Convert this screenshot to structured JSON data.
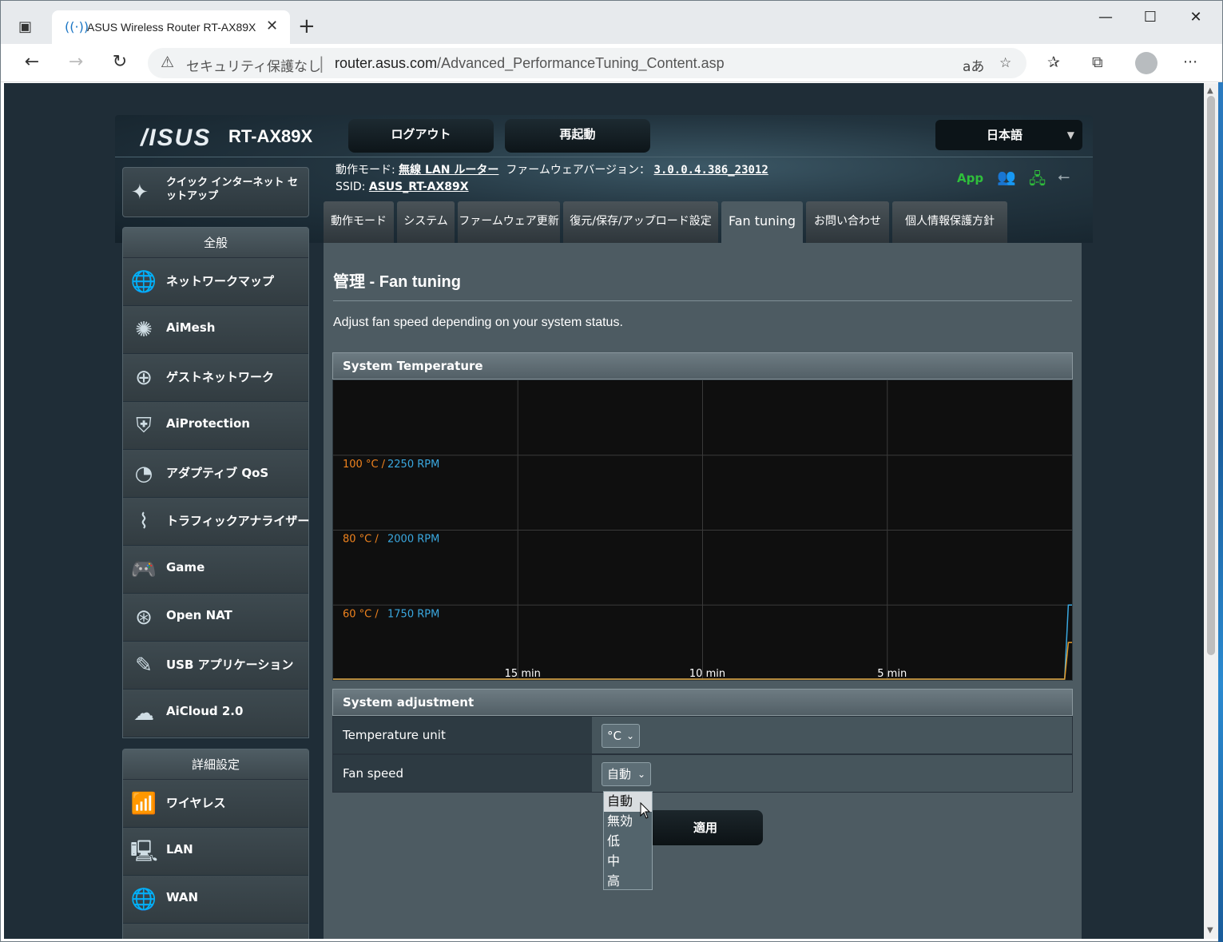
{
  "browser": {
    "tab_title": "ASUS Wireless Router RT-AX89X",
    "security_label": "セキュリティ保護なし",
    "url_host": "router.asus.com",
    "url_path": "/Advanced_PerformanceTuning_Content.asp"
  },
  "header": {
    "brand": "/ISUS",
    "model": "RT-AX89X",
    "logout_label": "ログアウト",
    "reboot_label": "再起動",
    "language": "日本語",
    "op_mode_label": "動作モード:",
    "op_mode_value": "無線 LAN ルーター",
    "fw_label": "ファームウェアバージョン：",
    "fw_value": "3.0.0.4.386_23012",
    "ssid_label": "SSID:",
    "ssid_value": "ASUS_RT-AX89X",
    "app_label": "App"
  },
  "sidebar": {
    "qis_label": "クイック インターネット セットアップ",
    "general_header": "全般",
    "general_items": [
      {
        "label": "ネットワークマップ",
        "icon": "globe-network-icon"
      },
      {
        "label": "AiMesh",
        "icon": "aimesh-icon"
      },
      {
        "label": "ゲストネットワーク",
        "icon": "guest-network-icon"
      },
      {
        "label": "AiProtection",
        "icon": "shield-lock-icon"
      },
      {
        "label": "アダプティブ QoS",
        "icon": "gauge-icon"
      },
      {
        "label": "トラフィックアナライザー",
        "icon": "traffic-pulse-icon"
      },
      {
        "label": "Game",
        "icon": "gamepad-icon"
      },
      {
        "label": "Open NAT",
        "icon": "open-nat-icon"
      },
      {
        "label": "USB アプリケーション",
        "icon": "usb-icon"
      },
      {
        "label": "AiCloud 2.0",
        "icon": "cloud-icon"
      }
    ],
    "advanced_header": "詳細設定",
    "advanced_items": [
      {
        "label": "ワイヤレス",
        "icon": "wireless-icon"
      },
      {
        "label": "LAN",
        "icon": "lan-icon"
      },
      {
        "label": "WAN",
        "icon": "wan-globe-icon"
      }
    ]
  },
  "tabs": [
    "動作モード",
    "システム",
    "ファームウェア更新",
    "復元/保存/アップロード設定",
    "Fan tuning",
    "お問い合わせ",
    "個人情報保護方針"
  ],
  "active_tab": "Fan tuning",
  "main": {
    "title": "管理 - Fan tuning",
    "description": "Adjust fan speed depending on your system status.",
    "temp_panel_title": "System Temperature",
    "adjust_panel_title": "System adjustment",
    "temp_unit_label": "Temperature unit",
    "temp_unit_value": "°C",
    "fan_speed_label": "Fan speed",
    "fan_speed_value": "自動",
    "fan_speed_options": [
      "自動",
      "無効",
      "低",
      "中",
      "高"
    ],
    "apply_label": "適用"
  },
  "chart_data": {
    "type": "line",
    "title": "System Temperature",
    "x_tick_labels": [
      "15 min",
      "10 min",
      "5 min"
    ],
    "y_levels": [
      {
        "temp": "100 °C",
        "rpm": "2250 RPM"
      },
      {
        "temp": "80 °C",
        "rpm": "2000 RPM"
      },
      {
        "temp": "60 °C",
        "rpm": "1750 RPM"
      }
    ],
    "series": [
      {
        "name": "",
        "color": "#3aa8e0",
        "unit": "RPM",
        "points": [
          [
            0.2,
            1500
          ],
          [
            0.1,
            1750
          ],
          [
            0.0,
            1750
          ]
        ]
      },
      {
        "name": "",
        "color": "#e39a2a",
        "unit": "°C",
        "points": [
          [
            0.2,
            40
          ],
          [
            0.1,
            50
          ],
          [
            0.0,
            50
          ]
        ]
      }
    ],
    "temp_label_color": "#f0831e",
    "rpm_label_color": "#3aa8e0",
    "grid": true
  }
}
